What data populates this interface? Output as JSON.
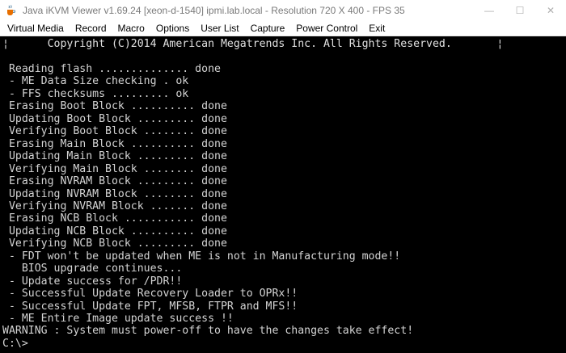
{
  "window": {
    "title": "Java iKVM Viewer v1.69.24 [xeon-d-1540] ipmi.lab.local - Resolution 720 X 400 - FPS 35",
    "icon": "java-cup-icon",
    "controls": [
      {
        "name": "minimize",
        "glyph": "—"
      },
      {
        "name": "maximize",
        "glyph": "☐"
      },
      {
        "name": "close",
        "glyph": "✕"
      }
    ]
  },
  "menu": [
    "Virtual Media",
    "Record",
    "Macro",
    "Options",
    "User List",
    "Capture",
    "Power Control",
    "Exit"
  ],
  "console": {
    "banner": "¦      Copyright (C)2014 American Megatrends Inc. All Rights Reserved.       ¦",
    "lines": [
      " Reading flash .............. done",
      " - ME Data Size checking . ok",
      " - FFS checksums ......... ok",
      " Erasing Boot Block .......... done",
      " Updating Boot Block ......... done",
      " Verifying Boot Block ........ done",
      " Erasing Main Block .......... done",
      " Updating Main Block ......... done",
      " Verifying Main Block ........ done",
      " Erasing NVRAM Block ......... done",
      " Updating NVRAM Block ........ done",
      " Verifying NVRAM Block ....... done",
      " Erasing NCB Block ........... done",
      " Updating NCB Block .......... done",
      " Verifying NCB Block ......... done",
      " - FDT won't be updated when ME is not in Manufacturing mode!!",
      "   BIOS upgrade continues...",
      " - Update success for /PDR!!",
      " - Successful Update Recovery Loader to OPRx!!",
      " - Successful Update FPT, MFSB, FTPR and MFS!!",
      " - ME Entire Image update success !!",
      "WARNING : System must power-off to have the changes take effect!",
      "C:\\>"
    ]
  }
}
